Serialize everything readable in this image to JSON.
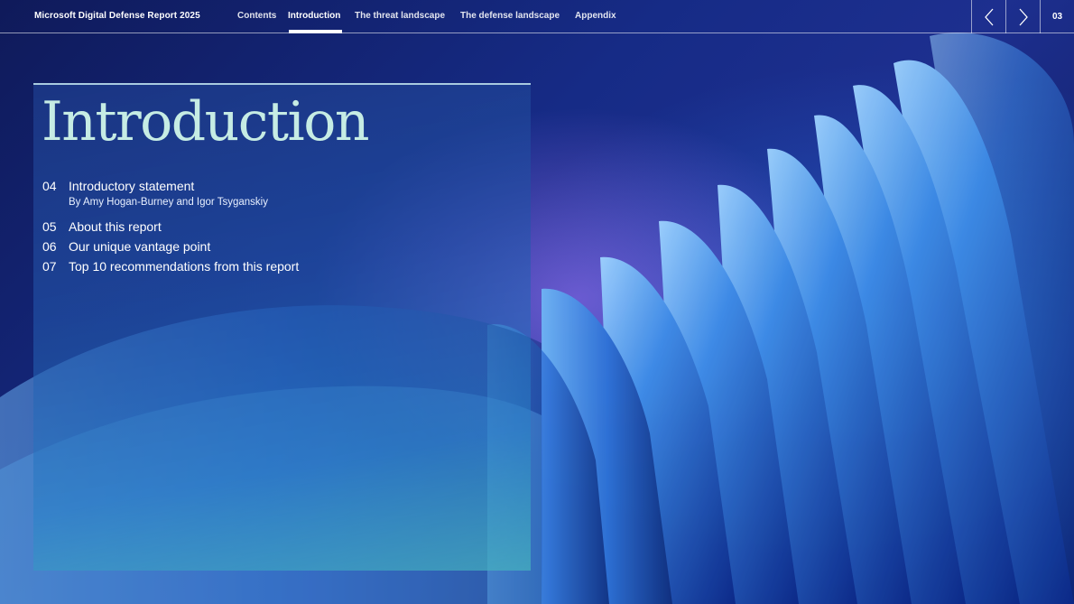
{
  "report_title": "Microsoft Digital Defense Report 2025",
  "nav": {
    "items": [
      "Contents",
      "Introduction",
      "The threat landscape",
      "The defense landscape",
      "Appendix"
    ],
    "active": "Introduction",
    "prev_icon": "chevron-left-icon",
    "next_icon": "chevron-right-icon",
    "page_number": "03"
  },
  "section": {
    "title": "Introduction",
    "toc": [
      {
        "num": "04",
        "label": "Introductory statement",
        "sub": "By Amy Hogan-Burney and Igor Tsyganskiy"
      },
      {
        "num": "05",
        "label": "About this report"
      },
      {
        "num": "06",
        "label": "Our unique vantage point"
      },
      {
        "num": "07",
        "label": "Top 10 recommendations from this report"
      }
    ]
  },
  "colors": {
    "title": "#c6ece4",
    "panel_border": "#a9cbe0",
    "background": "#162b86"
  }
}
